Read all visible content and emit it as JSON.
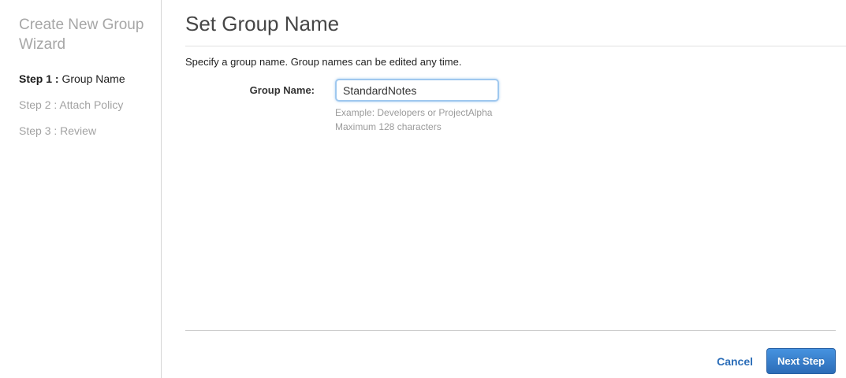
{
  "sidebar": {
    "title": "Create New Group Wizard",
    "steps": [
      {
        "prefix": "Step 1 :",
        "label": "Group Name",
        "active": true
      },
      {
        "prefix": "Step 2 :",
        "label": "Attach Policy",
        "active": false
      },
      {
        "prefix": "Step 3 :",
        "label": "Review",
        "active": false
      }
    ]
  },
  "main": {
    "title": "Set Group Name",
    "description": "Specify a group name. Group names can be edited any time.",
    "form": {
      "group_name_label": "Group Name:",
      "group_name_value": "StandardNotes",
      "hint_example": "Example: Developers or ProjectAlpha",
      "hint_max": "Maximum 128 characters"
    },
    "footer": {
      "cancel_label": "Cancel",
      "next_label": "Next Step"
    }
  },
  "colors": {
    "link_blue": "#2b6db8",
    "button_gradient_top": "#4693e0",
    "button_gradient_bottom": "#2c6cb7",
    "input_focus_border": "#9fc8ef"
  }
}
